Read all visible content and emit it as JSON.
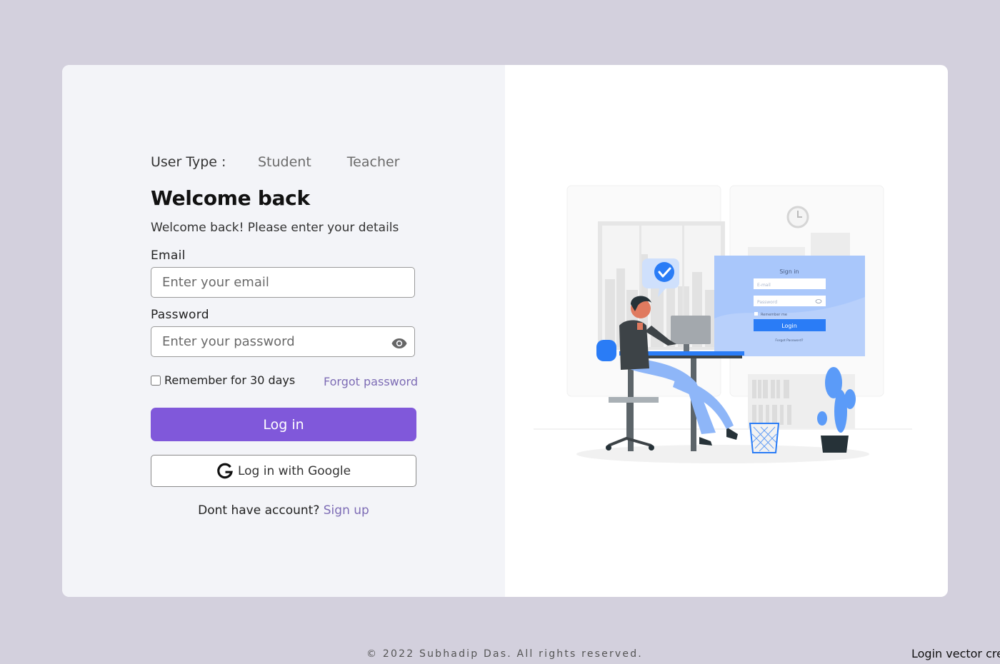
{
  "user_type": {
    "label": "User Type :",
    "tabs": [
      "Student",
      "Teacher"
    ]
  },
  "heading": {
    "title": "Welcome back",
    "subtitle": "Welcome back! Please enter your details"
  },
  "form": {
    "email_label": "Email",
    "email_placeholder": "Enter your email",
    "password_label": "Password",
    "password_placeholder": "Enter your password",
    "remember_label": "Remember for 30 days",
    "forgot_label": "Forgot password",
    "login_label": "Log in",
    "google_label": "Log in with Google",
    "signup_prompt": "Dont have account?",
    "signup_label": "Sign up"
  },
  "illustration": {
    "sign_in_title": "Sign in",
    "email_placeholder": "E-mail",
    "password_placeholder": "Password",
    "remember_label": "Remember me",
    "login_label": "Login",
    "forgot_label": "Forgot Password?"
  },
  "footer": {
    "copyright": "© 2022 Subhadip Das. All rights reserved.",
    "credit": "Login vector crea"
  },
  "colors": {
    "accent": "#8058da",
    "link": "#7d6cb5",
    "background": "#d3d0dd",
    "illustration_blue": "#2a7cf6"
  }
}
